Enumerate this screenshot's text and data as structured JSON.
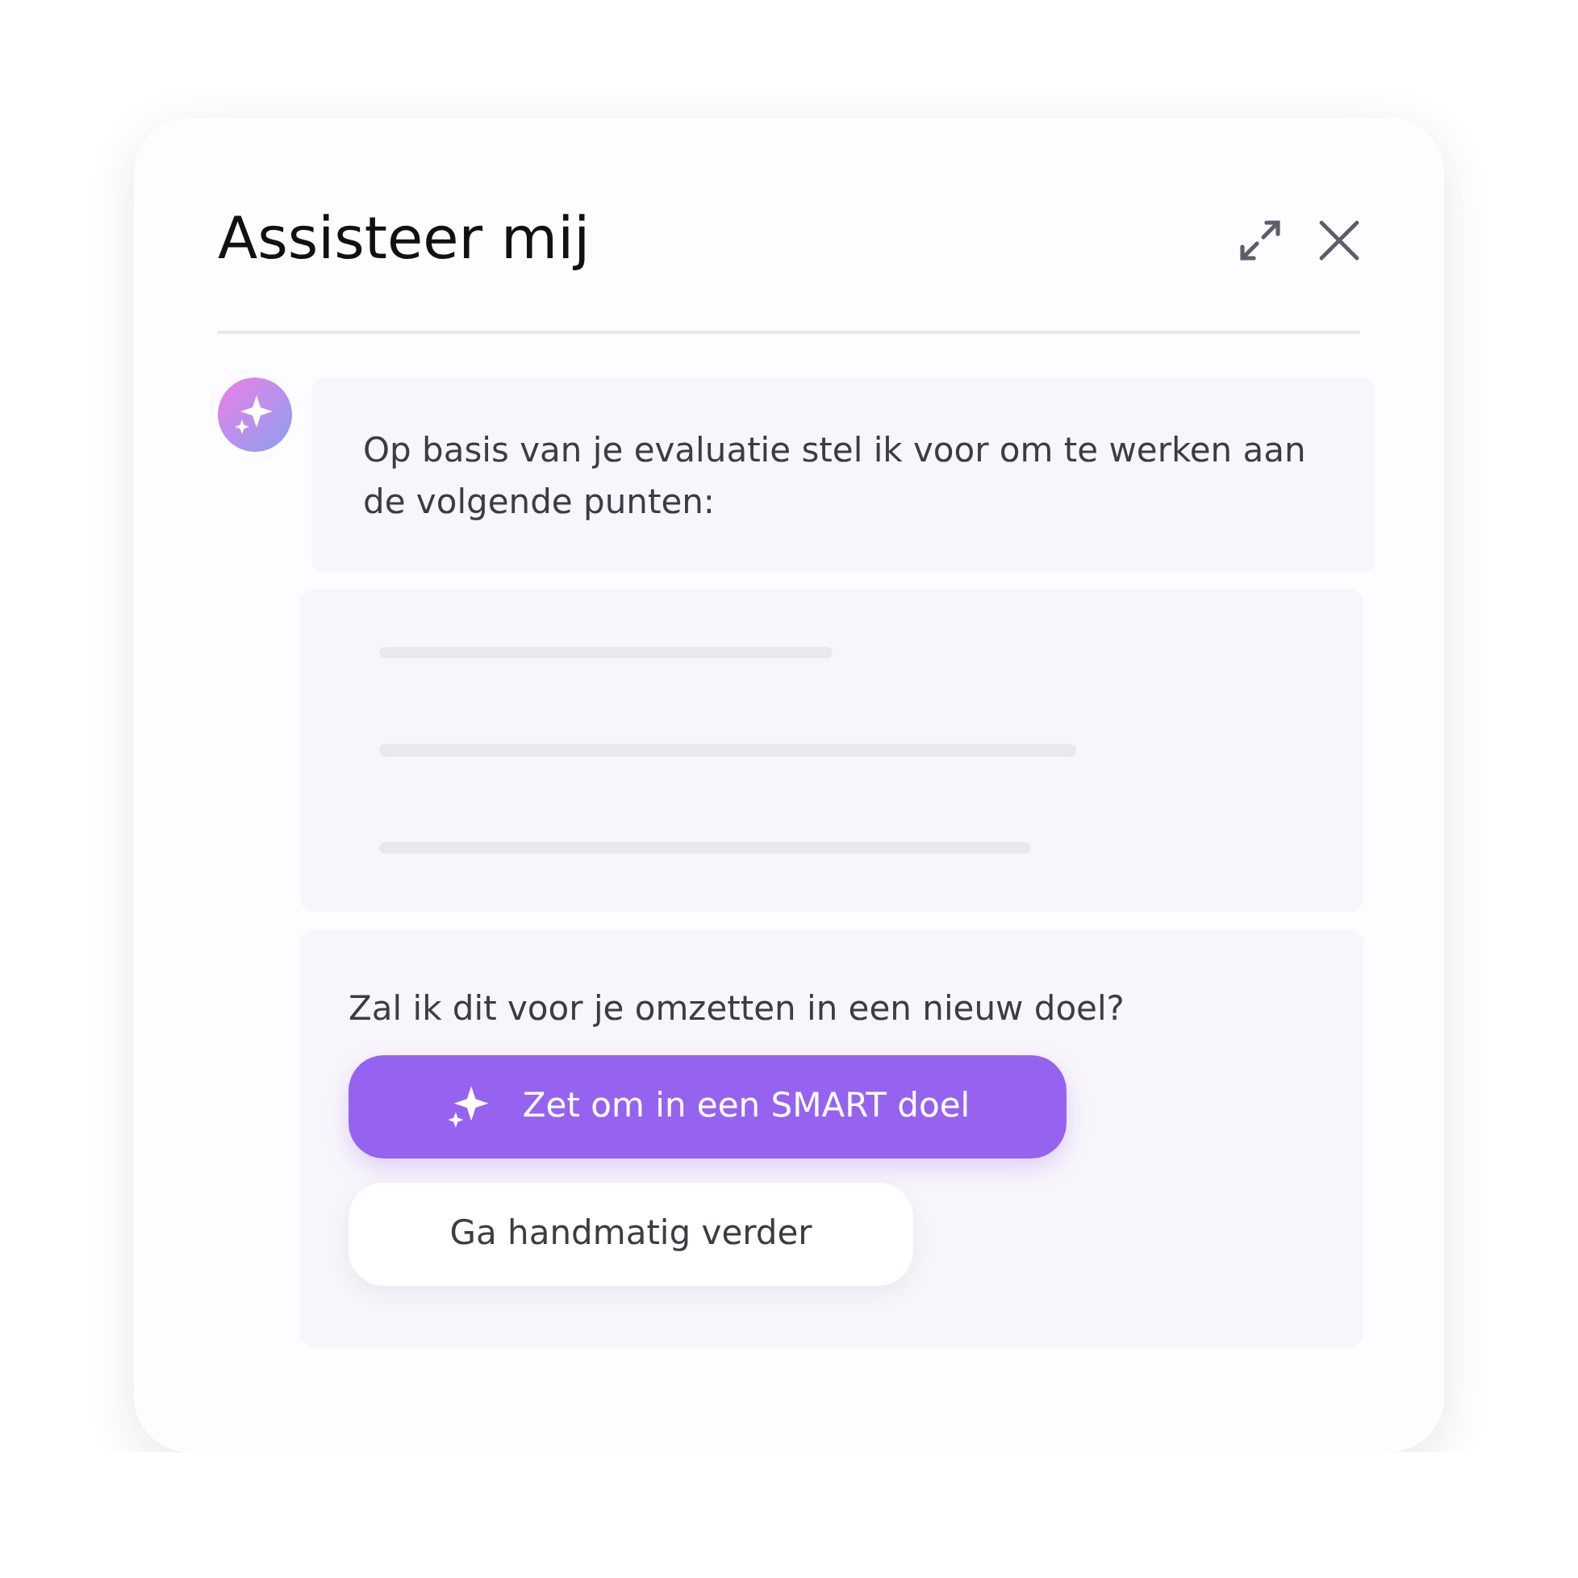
{
  "panel": {
    "title": "Assisteer mij"
  },
  "message": {
    "text": "Op basis van je evaluatie stel ik voor om te werken aan de volgende punten:"
  },
  "suggestions": {
    "kind": "loading"
  },
  "question": {
    "text": "Zal ik dit voor je omzetten in een nieuw doel?"
  },
  "buttons": [
    {
      "label": "Zet om in een SMART doel",
      "kind": "primary"
    },
    {
      "label": "Ga handmatig verder",
      "kind": "secondary"
    }
  ]
}
